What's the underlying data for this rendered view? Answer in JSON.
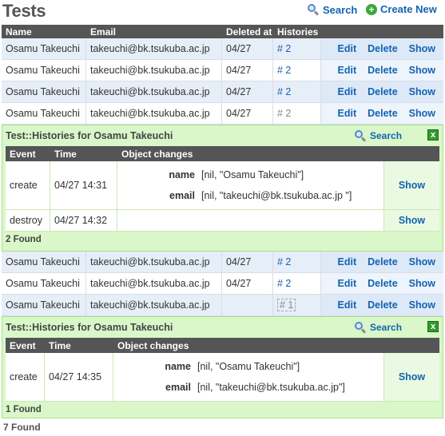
{
  "page": {
    "title": "Tests",
    "search_label": "Search",
    "create_label": "Create New",
    "footer_found": "7 Found"
  },
  "columns": {
    "name": "Name",
    "email": "Email",
    "deleted_at": "Deleted at",
    "histories": "Histories"
  },
  "actions": {
    "edit": "Edit",
    "delete": "Delete",
    "show": "Show"
  },
  "records": [
    {
      "name": "Osamu Takeuchi",
      "email": "takeuchi@bk.tsukuba.ac.jp",
      "deleted_at": "04/27",
      "histories": "# 2"
    },
    {
      "name": "Osamu Takeuchi",
      "email": "takeuchi@bk.tsukuba.ac.jp",
      "deleted_at": "04/27",
      "histories": "# 2"
    },
    {
      "name": "Osamu Takeuchi",
      "email": "takeuchi@bk.tsukuba.ac.jp",
      "deleted_at": "04/27",
      "histories": "# 2"
    },
    {
      "name": "Osamu Takeuchi",
      "email": "takeuchi@bk.tsukuba.ac.jp",
      "deleted_at": "04/27",
      "histories": "# 2"
    },
    {
      "name": "Osamu Takeuchi",
      "email": "takeuchi@bk.tsukuba.ac.jp",
      "deleted_at": "04/27",
      "histories": "# 2"
    },
    {
      "name": "Osamu Takeuchi",
      "email": "takeuchi@bk.tsukuba.ac.jp",
      "deleted_at": "04/27",
      "histories": "# 2"
    },
    {
      "name": "Osamu Takeuchi",
      "email": "takeuchi@bk.tsukuba.ac.jp",
      "deleted_at": "",
      "histories": "# 1"
    }
  ],
  "history_panel_1": {
    "title": "Test::Histories for Osamu Takeuchi",
    "search_label": "Search",
    "close_label": "x",
    "headers": {
      "event": "Event",
      "time": "Time",
      "changes": "Object changes"
    },
    "rows": [
      {
        "event": "create",
        "time": "04/27 14:31",
        "changes": [
          {
            "key": "name",
            "value": "[nil, \"Osamu Takeuchi\"]"
          },
          {
            "key": "email",
            "value": "[nil, \"takeuchi@bk.tsukuba.ac.jp \"]"
          }
        ]
      },
      {
        "event": "destroy",
        "time": "04/27 14:32",
        "changes": []
      }
    ],
    "found": "2 Found"
  },
  "history_panel_2": {
    "title": "Test::Histories for Osamu Takeuchi",
    "search_label": "Search",
    "close_label": "x",
    "headers": {
      "event": "Event",
      "time": "Time",
      "changes": "Object changes"
    },
    "rows": [
      {
        "event": "create",
        "time": "04/27 14:35",
        "changes": [
          {
            "key": "name",
            "value": "[nil, \"Osamu Takeuchi\"]"
          },
          {
            "key": "email",
            "value": "[nil, \"takeuchi@bk.tsukuba.ac.jp\"]"
          }
        ]
      }
    ],
    "found": "1 Found"
  }
}
